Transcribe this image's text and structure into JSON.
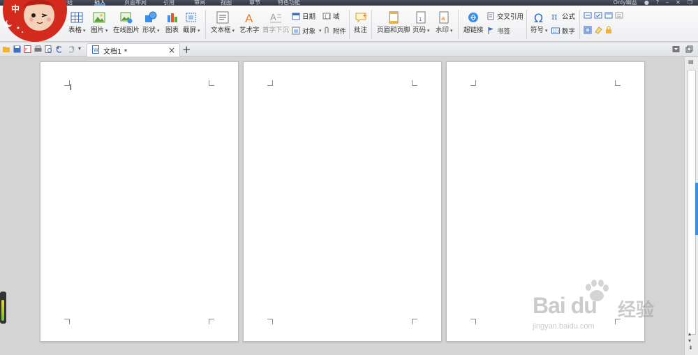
{
  "menubar": {
    "tabs": [
      {
        "label": "开始",
        "x_hint": "home"
      },
      {
        "label": "插入",
        "active": true
      },
      {
        "label": "页面布局"
      },
      {
        "label": "引用"
      },
      {
        "label": "审阅"
      },
      {
        "label": "视图"
      },
      {
        "label": "章节"
      },
      {
        "label": "特色功能"
      }
    ],
    "user": "Only幽蓝"
  },
  "ribbon": {
    "table": "表格",
    "picture": "图片",
    "online_picture": "在线图片",
    "shape": "形状",
    "chart": "图表",
    "screenshot": "截屏",
    "textbox": "文本框",
    "wordart": "艺术字",
    "dropcap": "首字下沉",
    "date": "日期",
    "field": "域",
    "object": "对象",
    "attachment": "附件",
    "comment": "批注",
    "header_footer": "页眉和页脚",
    "page_number": "页码",
    "watermark": "水印",
    "hyperlink": "超链接",
    "cross_ref": "交叉引用",
    "bookmark": "书签",
    "symbol": "符号",
    "formula": "公式",
    "number": "数字",
    "mascot_badge": "中"
  },
  "doc": {
    "tab_title": "文档1 *",
    "add_tab": "+",
    "close": "×"
  },
  "watermark": {
    "brand": "Bai du",
    "cn": "经验",
    "url": "jingyan.baidu.com"
  },
  "colors": {
    "accent": "#3a8ee6",
    "menubar": "#3a3e48"
  }
}
